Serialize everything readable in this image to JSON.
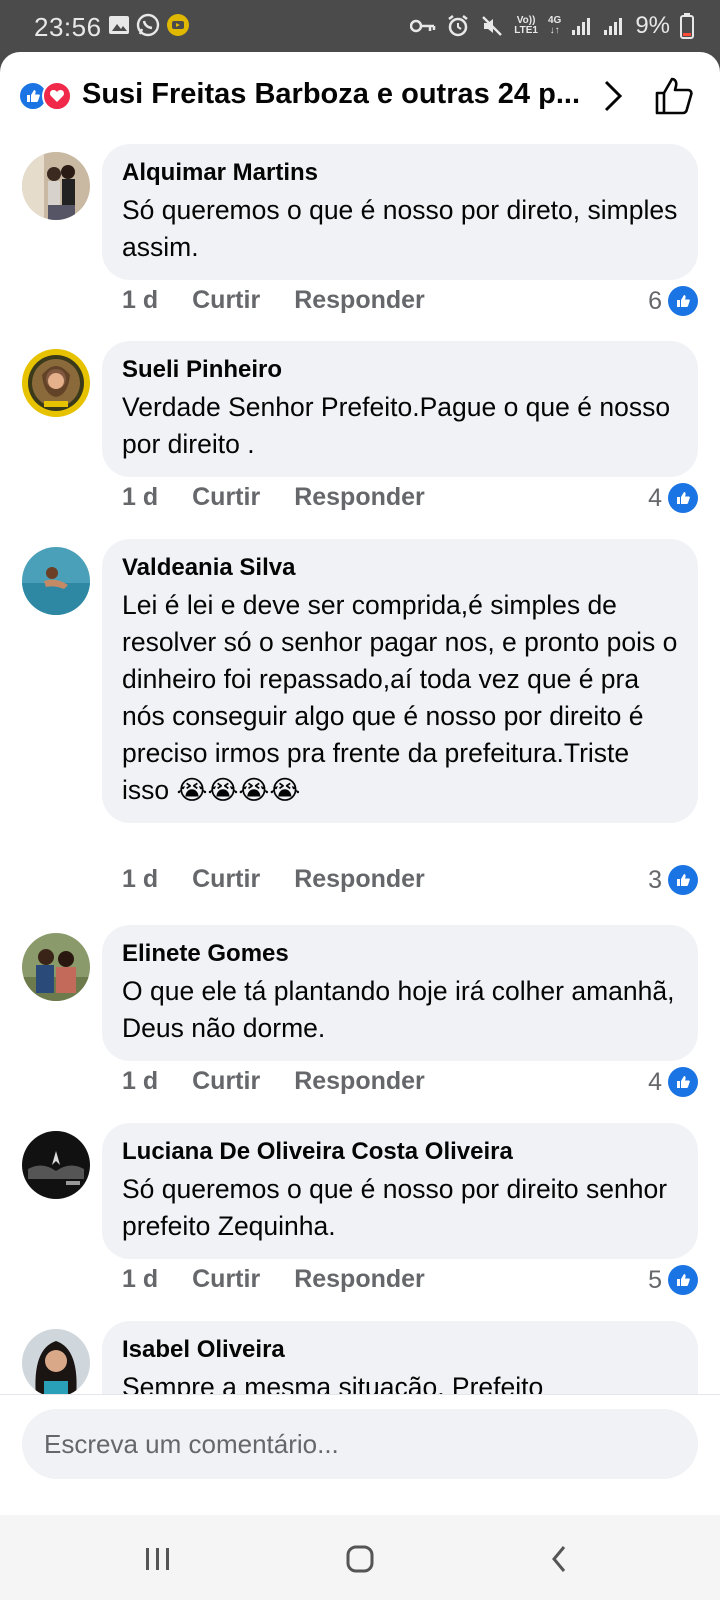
{
  "status_bar": {
    "time": "23:56",
    "network_top": "Vo))",
    "network_bottom": "LTE1",
    "gen_top": "4G",
    "gen_bottom": "↓↑",
    "battery": "9%"
  },
  "header": {
    "title": "Susi Freitas Barboza e outras 24 p..."
  },
  "comments": [
    {
      "author": "Alquimar Martins",
      "text": "Só queremos o que é nosso por direto, simples assim.",
      "time": "1 d",
      "like_label": "Curtir",
      "reply_label": "Responder",
      "likes": "6"
    },
    {
      "author": "Sueli Pinheiro",
      "text": "Verdade Senhor Prefeito.Pague o que é nosso por direito .",
      "time": "1 d",
      "like_label": "Curtir",
      "reply_label": "Responder",
      "likes": "4"
    },
    {
      "author": "Valdeania Silva",
      "text": "Lei é lei e deve ser comprida,é simples de resolver só o senhor pagar nos, e pronto pois o dinheiro foi repassado,aí toda vez que é pra nós conseguir algo que é nosso por direito é preciso irmos pra frente da prefeitura.Triste isso 😭😭😭😭",
      "time": "1 d",
      "like_label": "Curtir",
      "reply_label": "Responder",
      "likes": "3"
    },
    {
      "author": "Elinete Gomes",
      "text": "O que ele tá plantando hoje irá colher amanhã, Deus não dorme.",
      "time": "1 d",
      "like_label": "Curtir",
      "reply_label": "Responder",
      "likes": "4"
    },
    {
      "author": "Luciana De Oliveira Costa Oliveira",
      "text": "Só queremos o que é nosso por direito senhor prefeito Zequinha.",
      "time": "1 d",
      "like_label": "Curtir",
      "reply_label": "Responder",
      "likes": "5"
    },
    {
      "author": "Isabel Oliveira",
      "text": "Sempre a mesma situação. Prefeito"
    }
  ],
  "composer": {
    "placeholder": "Escreva um comentário..."
  },
  "colors": {
    "accent": "#1b74e4",
    "love": "#f0284a",
    "bubble": "#f0f2f5",
    "meta_text": "#65676b"
  }
}
